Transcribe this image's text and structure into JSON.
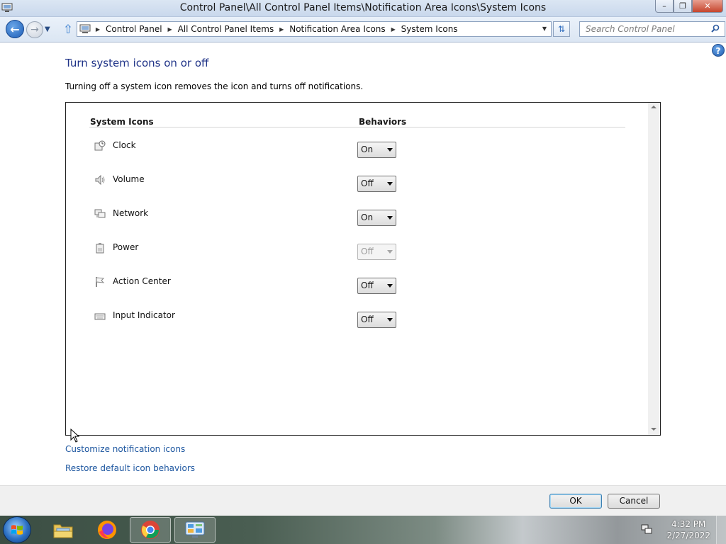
{
  "window": {
    "title": "Control Panel\\All Control Panel Items\\Notification Area Icons\\System Icons",
    "minimize_icon": "minimize-icon",
    "maximize_icon": "restore-icon",
    "close_icon": "close-icon"
  },
  "navigation": {
    "breadcrumbs": [
      "Control Panel",
      "All Control Panel Items",
      "Notification Area Icons",
      "System Icons"
    ],
    "search_placeholder": "Search Control Panel"
  },
  "page": {
    "title": "Turn system icons on or off",
    "description": "Turning off a system icon removes the icon and turns off notifications."
  },
  "table": {
    "column_system_icons": "System Icons",
    "column_behaviors": "Behaviors",
    "rows": [
      {
        "label": "Clock",
        "icon": "clock-icon",
        "value": "On",
        "enabled": true
      },
      {
        "label": "Volume",
        "icon": "volume-icon",
        "value": "Off",
        "enabled": true
      },
      {
        "label": "Network",
        "icon": "network-icon",
        "value": "On",
        "enabled": true
      },
      {
        "label": "Power",
        "icon": "power-icon",
        "value": "Off",
        "enabled": false
      },
      {
        "label": "Action Center",
        "icon": "flag-icon",
        "value": "Off",
        "enabled": true
      },
      {
        "label": "Input Indicator",
        "icon": "keyboard-icon",
        "value": "Off",
        "enabled": true
      }
    ]
  },
  "links": {
    "customize": "Customize notification icons",
    "restore": "Restore default icon behaviors"
  },
  "buttons": {
    "ok": "OK",
    "cancel": "Cancel"
  },
  "taskbar": {
    "time": "4:32 PM",
    "date": "2/27/2022",
    "apps": [
      "file-explorer-icon",
      "firefox-icon",
      "chrome-icon",
      "control-panel-icon"
    ]
  },
  "colors": {
    "title_blue": "#1e3287",
    "link_blue": "#1e57a0"
  }
}
